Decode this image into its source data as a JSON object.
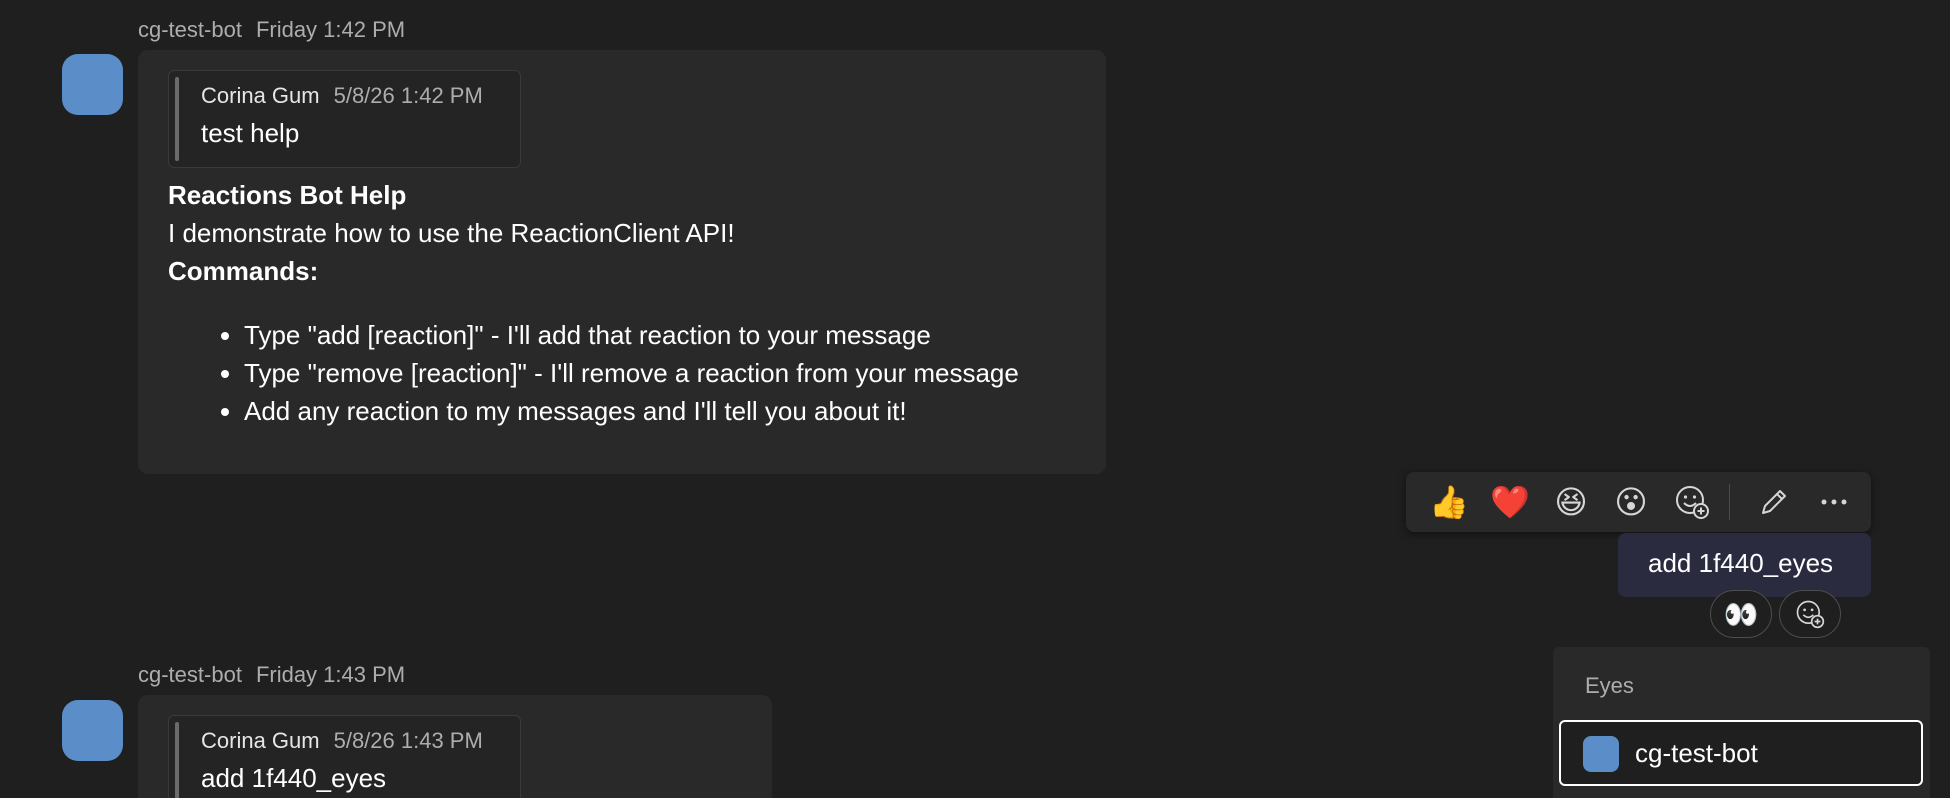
{
  "messages": [
    {
      "sender": "cg-test-bot",
      "time": "Friday 1:42 PM",
      "quote": {
        "author": "Corina Gum",
        "time": "5/8/26 1:42 PM",
        "text": "test help"
      },
      "title": "Reactions Bot Help",
      "intro": "I demonstrate how to use the ReactionClient API!",
      "commands_heading": "Commands:",
      "commands": [
        "Type \"add [reaction]\" - I'll add that reaction to your message",
        "Type \"remove [reaction]\" - I'll remove a reaction from your message",
        "Add any reaction to my messages and I'll tell you about it!"
      ]
    },
    {
      "sender": "cg-test-bot",
      "time": "Friday 1:43 PM",
      "quote": {
        "author": "Corina Gum",
        "time": "5/8/26 1:43 PM",
        "text": "add 1f440_eyes"
      }
    }
  ],
  "toolbar": {
    "reactions": [
      "👍",
      "❤️",
      "😆",
      "😮"
    ],
    "add_reaction_icon": "add-reaction-icon",
    "edit_icon": "pencil-icon",
    "more_icon": "more-options-icon"
  },
  "own_message": {
    "text": "add 1f440_eyes",
    "reaction": "👀"
  },
  "reaction_popup": {
    "title": "Eyes",
    "users": [
      "cg-test-bot"
    ]
  },
  "colors": {
    "background": "#1f1f1f",
    "bubble": "#292929",
    "own_bubble": "#2b2b40",
    "avatar": "#5b8ec9"
  }
}
